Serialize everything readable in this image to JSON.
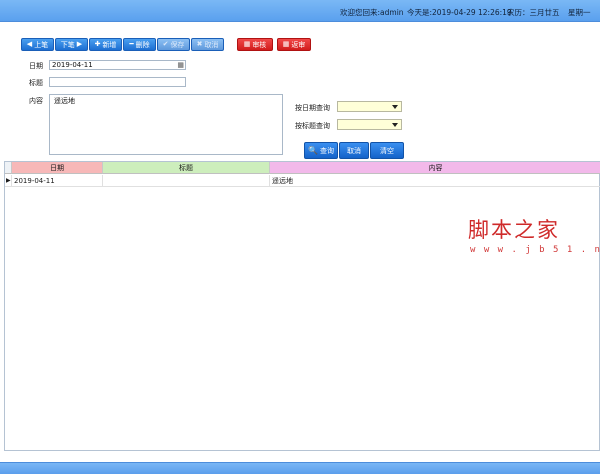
{
  "header": {
    "welcome": "欢迎您回来:admin",
    "today": "今天是:2019-04-29 12:26:19",
    "lunar": "农历：三月廿五",
    "weekday": "星期一"
  },
  "toolbar": {
    "prev": "上笔",
    "next": "下笔",
    "add": "新增",
    "delete": "删除",
    "save": "保存",
    "cancel": "取消",
    "audit": "审核",
    "unaudit": "返审"
  },
  "form": {
    "date_label": "日期",
    "date_value": "2019-04-11",
    "title_label": "标题",
    "title_value": "",
    "content_label": "内容",
    "content_value": "遥远地"
  },
  "query": {
    "by_date_label": "按日期查询",
    "by_title_label": "按标题查询",
    "by_date_value": "",
    "by_title_value": "",
    "search": "查询",
    "cancel": "取消",
    "clear": "清空"
  },
  "grid": {
    "columns": [
      {
        "label": "日期",
        "color": "#f7b8b8"
      },
      {
        "label": "标题",
        "color": "#cdeebc"
      },
      {
        "label": "内容",
        "color": "#f2b9ea"
      }
    ],
    "rows": [
      {
        "date": "2019-04-11",
        "title": "",
        "content": "遥远地"
      }
    ]
  },
  "watermark": {
    "cn": "脚本之家",
    "url": "w w w . j b 5 1 . n e t"
  },
  "colors": {
    "topbar": "#6aaef2",
    "button_blue": "#1d6fd2",
    "button_red": "#d21c1c",
    "select_bg": "#ffffd8"
  }
}
